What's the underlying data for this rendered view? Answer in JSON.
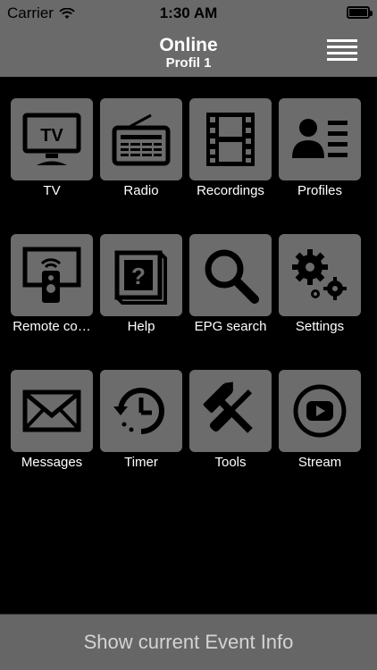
{
  "status_bar": {
    "carrier": "Carrier",
    "time": "1:30 AM"
  },
  "nav": {
    "title": "Online",
    "subtitle": "Profil 1"
  },
  "tiles": [
    {
      "label": "TV",
      "icon": "tv-icon"
    },
    {
      "label": "Radio",
      "icon": "radio-icon"
    },
    {
      "label": "Recordings",
      "icon": "film-strip-icon"
    },
    {
      "label": "Profiles",
      "icon": "profile-card-icon"
    },
    {
      "label": "Remote co…",
      "icon": "remote-control-icon"
    },
    {
      "label": "Help",
      "icon": "help-book-icon"
    },
    {
      "label": "EPG search",
      "icon": "magnifier-icon"
    },
    {
      "label": "Settings",
      "icon": "gears-icon"
    },
    {
      "label": "Messages",
      "icon": "envelope-icon"
    },
    {
      "label": "Timer",
      "icon": "history-clock-icon"
    },
    {
      "label": "Tools",
      "icon": "hammer-screwdriver-icon"
    },
    {
      "label": "Stream",
      "icon": "play-circle-icon"
    }
  ],
  "tv_icon_text": "TV",
  "help_icon_text": "?",
  "bottom": {
    "label": "Show current Event Info"
  }
}
